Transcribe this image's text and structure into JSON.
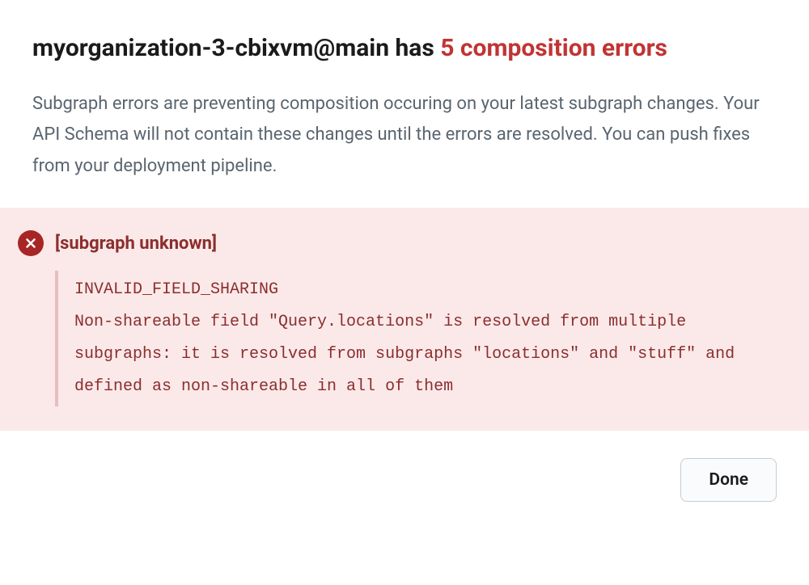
{
  "heading": {
    "prefix": "myorganization-3-cbixvm@main has ",
    "error_count_text": "5 composition errors"
  },
  "description": "Subgraph errors are preventing composition occuring on your latest subgraph changes. Your API Schema will not contain these changes until the errors are resolved. You can push fixes from your deployment pipeline.",
  "error": {
    "title": "[subgraph unknown]",
    "code": "INVALID_FIELD_SHARING",
    "message": "Non-shareable field \"Query.locations\" is resolved from multiple subgraphs: it is resolved from subgraphs \"locations\" and \"stuff\" and defined as non-shareable in all of them"
  },
  "footer": {
    "done_label": "Done"
  }
}
